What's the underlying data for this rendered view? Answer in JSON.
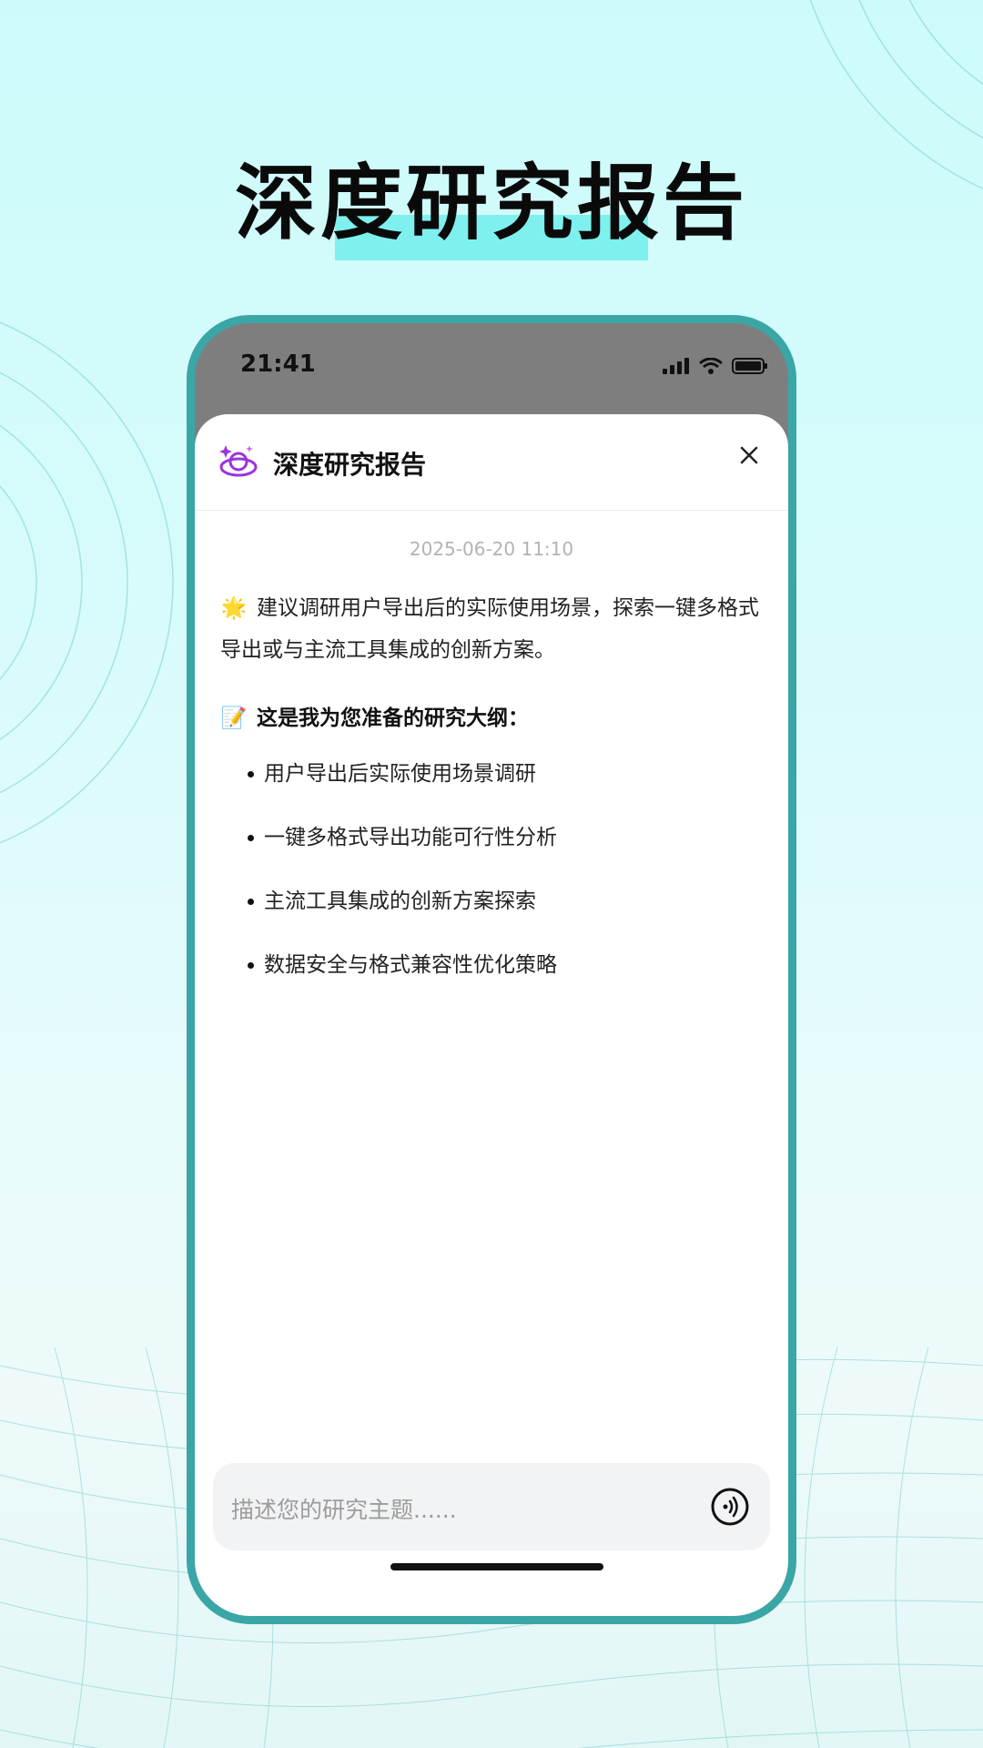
{
  "hero": {
    "title": "深度研究报告"
  },
  "status_bar": {
    "time": "21:41"
  },
  "sheet": {
    "title": "深度研究报告"
  },
  "chat": {
    "timestamp": "2025-06-20 11:10",
    "message": "建议调研用户导出后的实际使用场景，探索一键多格式导出或与主流工具集成的创新方案。",
    "message_emoji": "🌟",
    "outline_emoji": "📝",
    "outline_heading": "这是我为您准备的研究大纲：",
    "outline_items": [
      "用户导出后实际使用场景调研",
      "一键多格式导出功能可行性分析",
      "主流工具集成的创新方案探索",
      "数据安全与格式兼容性优化策略"
    ]
  },
  "input": {
    "placeholder": "描述您的研究主题......"
  },
  "colors": {
    "accent": "#3aa6a6",
    "highlight": "#7ef0ee",
    "brand_purple": "#9b34d9"
  }
}
